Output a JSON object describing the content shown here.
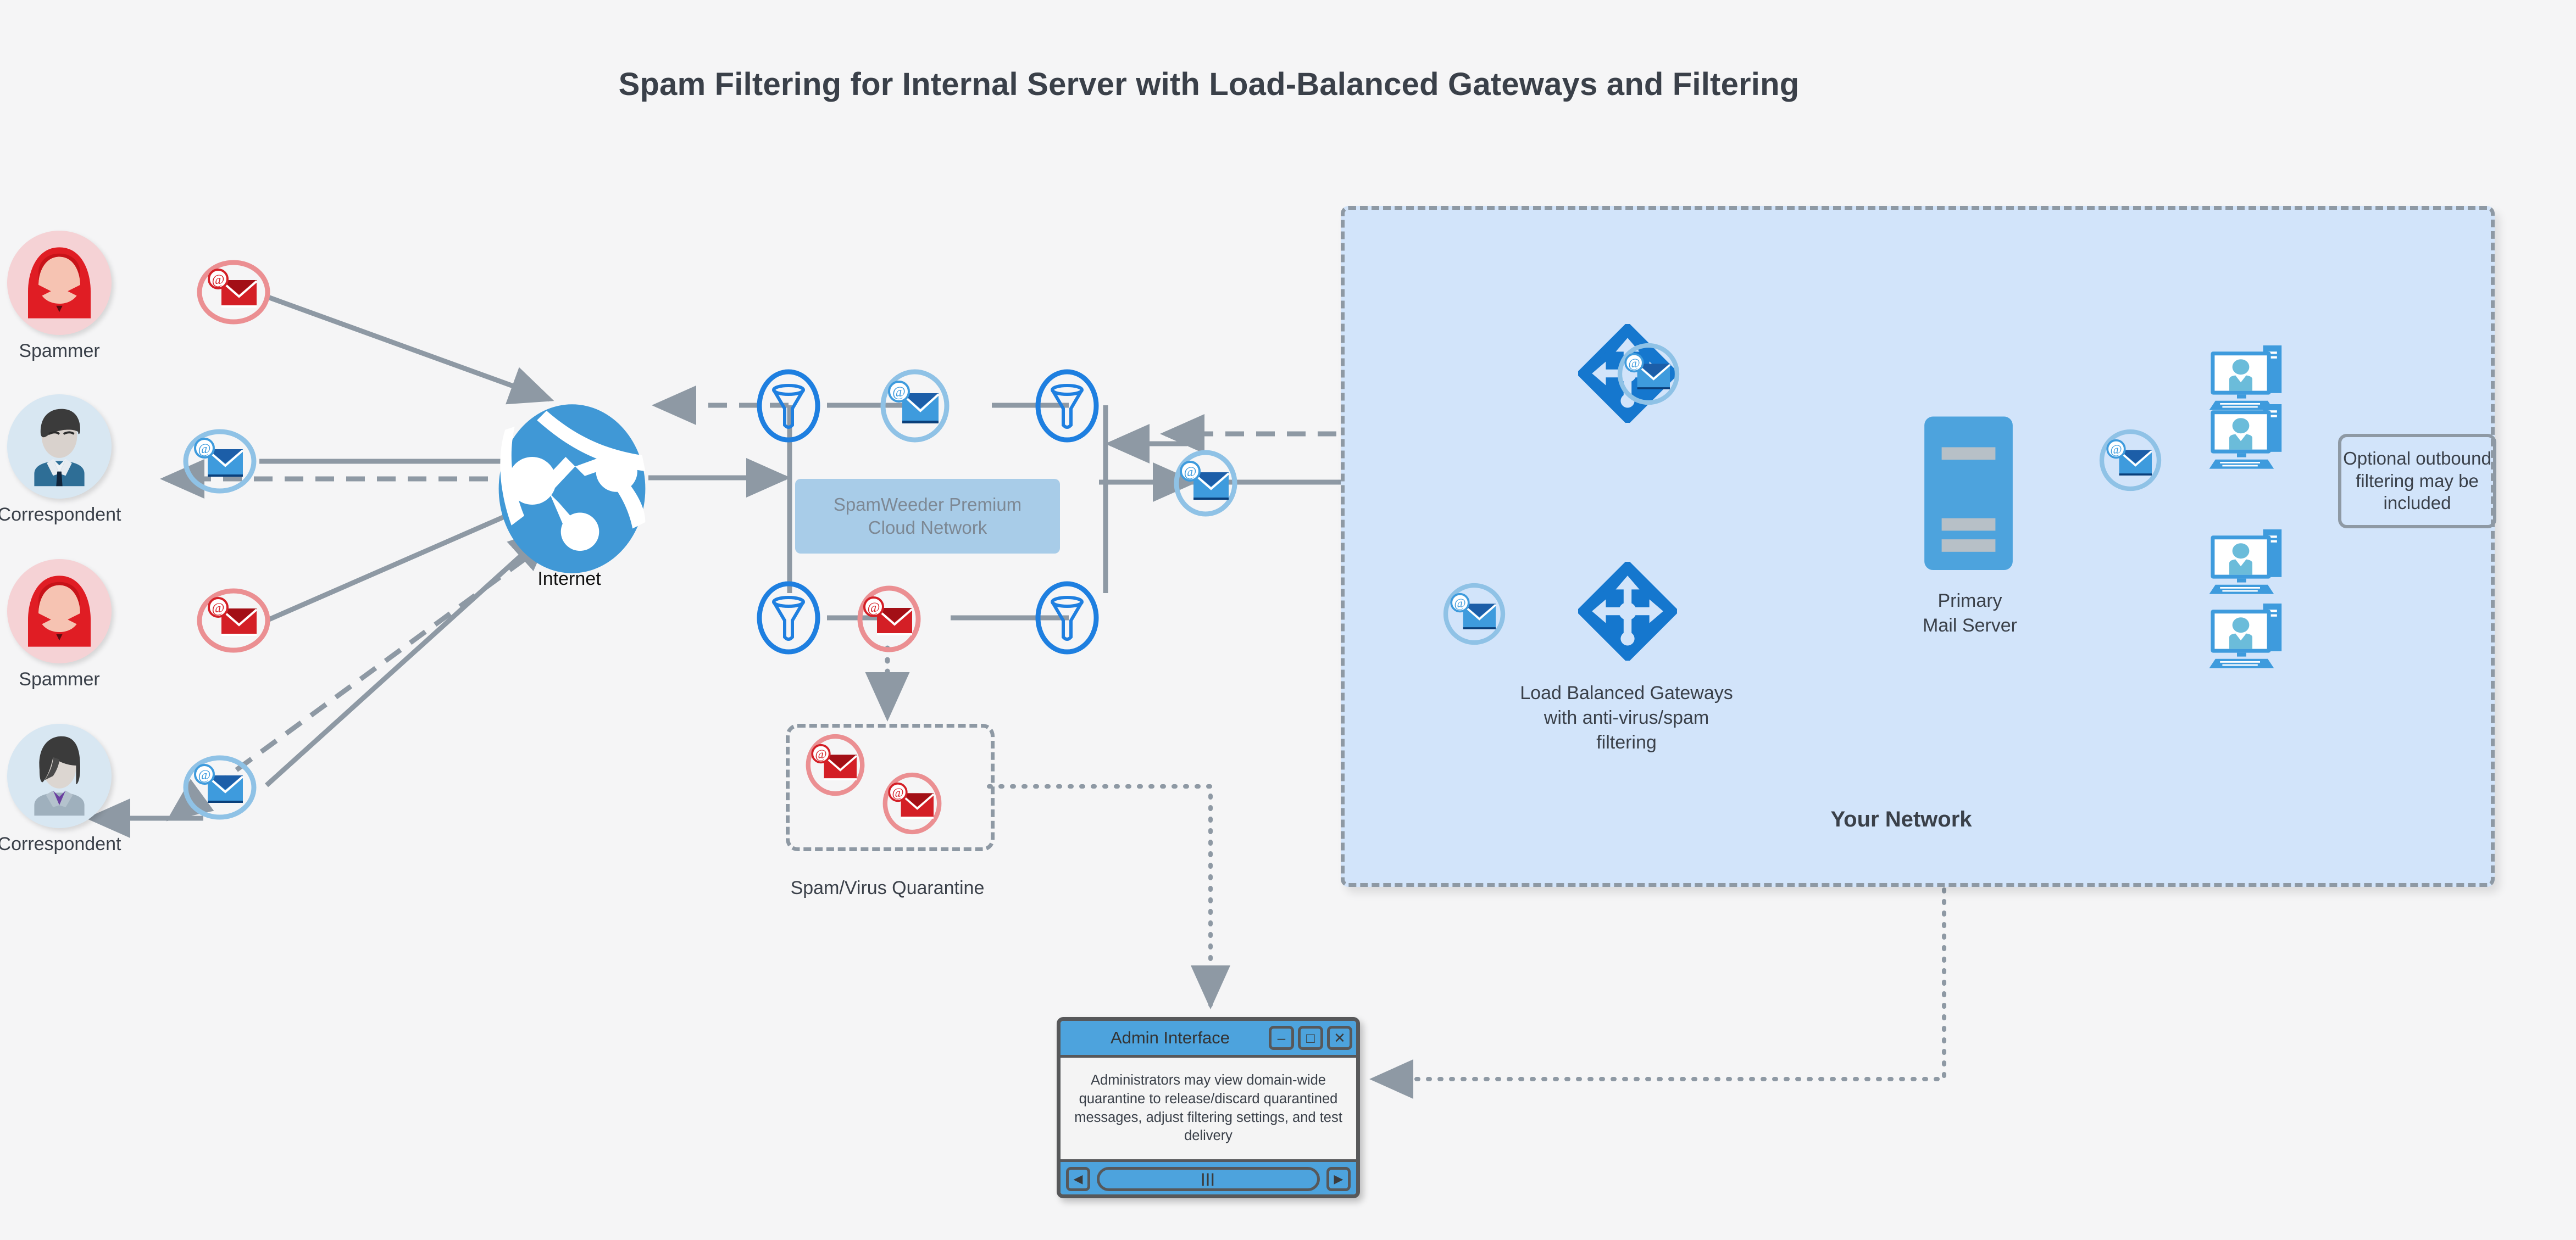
{
  "title": "Spam Filtering for Internal Server with Load-Balanced Gateways and Filtering",
  "senders": [
    {
      "label": "Spammer",
      "kind": "spammer",
      "mail": "spam-mail"
    },
    {
      "label": "Correspondent",
      "kind": "correspondent",
      "mail": "good-mail"
    },
    {
      "label": "Spammer",
      "kind": "spammer",
      "mail": "spam-mail"
    },
    {
      "label": "Correspondent",
      "kind": "correspondent",
      "mail": "good-mail"
    }
  ],
  "internet": {
    "label": "Internet",
    "icon": "globe-network-icon"
  },
  "cloud": {
    "band_line1": "SpamWeeder Premium",
    "band_line2": "Cloud Network",
    "filter_icon": "funnel-filter-icon",
    "good_mail_icon": "blue-envelope-at-icon",
    "spam_mail_icon": "red-envelope-at-icon"
  },
  "quarantine": {
    "label": "Spam/Virus Quarantine"
  },
  "network": {
    "label": "Your Network",
    "gateways_caption_l1": "Load Balanced Gateways",
    "gateways_caption_l2": "with anti-virus/spam",
    "gateways_caption_l3": "filtering",
    "gateway_icon": "router-diamond-icon",
    "mail_server_l1": "Primary",
    "mail_server_l2": "Mail Server",
    "mail_server_icon": "server-tower-icon",
    "client_icon": "desktop-user-icon",
    "optional_note": "Optional outbound filtering may be included"
  },
  "admin_window": {
    "title": "Admin Interface",
    "body": "Administrators may view domain-wide quarantine to release/discard quarantined messages, adjust filtering settings, and test delivery",
    "minimize": "–",
    "maximize": "□",
    "close": "✕",
    "scroll_left": "◀",
    "scroll_right": "▶",
    "scroll_grip": "|||"
  },
  "colors": {
    "page_bg": "#f5f5f6",
    "network_bg": "#d2e4fa",
    "accent_blue": "#4da3dd",
    "deep_blue": "#1577ce",
    "spam_red": "#d41f26",
    "wire_gray": "#8e99a4",
    "text_dark": "#3a4049",
    "band_blue": "#a8cce8"
  }
}
